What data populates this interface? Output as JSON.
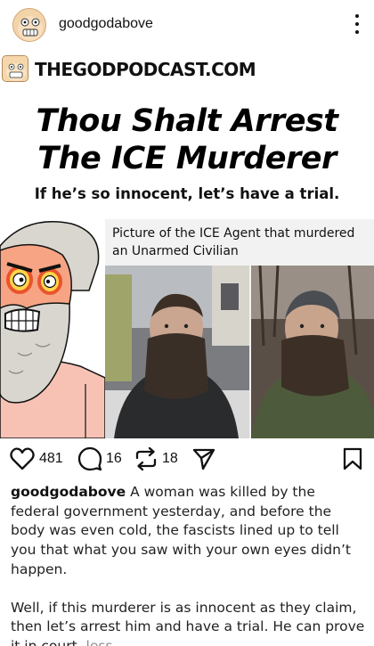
{
  "header": {
    "username": "goodgodabove",
    "avatar_icon": "cartoon-face-avatar",
    "more_icon": "more-vertical-icon"
  },
  "post": {
    "brand": "THEGODPODCAST.COM",
    "headline_line1": "Thou Shalt Arrest",
    "headline_line2": "The ICE Murderer",
    "subhead": "If he’s so innocent, let’s have a trial.",
    "photo_caption": "Picture of the ICE Agent that murdered an Unarmed Civilian"
  },
  "actions": {
    "likes": "481",
    "comments": "16",
    "reposts": "18"
  },
  "caption": {
    "username": "goodgodabove",
    "text1": " A woman was killed by the federal government yesterday, and before the body was even cold, the fascists lined up to tell you that what you saw with your own eyes didn’t happen.",
    "text2": "Well, if this murderer is as innocent as they claim, then let’s arrest him and have a trial. He can prove it in court. ",
    "less_label": "less"
  },
  "colors": {
    "cartoon_skin": "#f6a484",
    "cartoon_hair": "#d9d6cf",
    "cartoon_fire": "#e9542b",
    "muted": "#8e8e8e"
  }
}
